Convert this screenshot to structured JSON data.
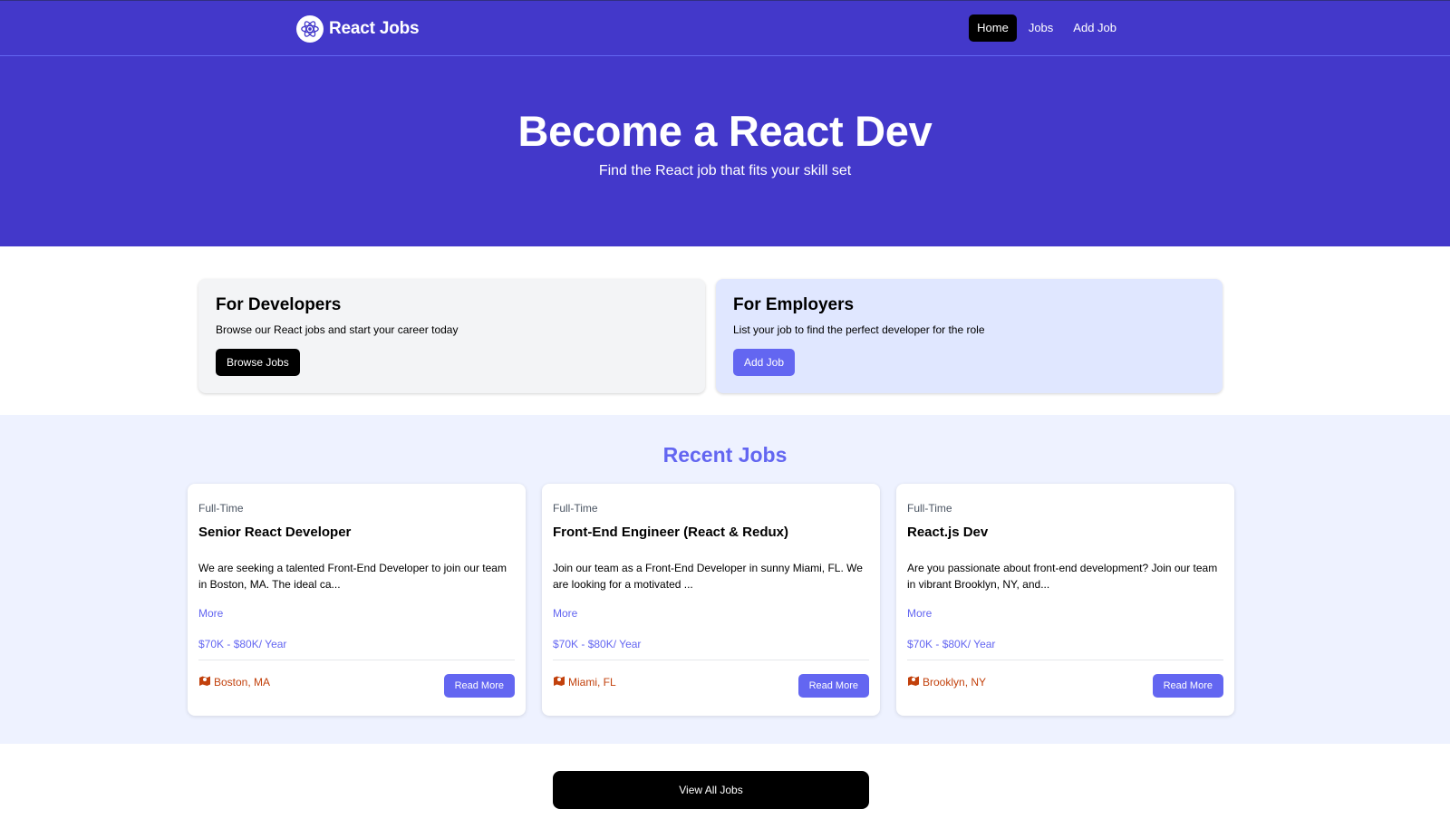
{
  "nav": {
    "brand": "React Jobs",
    "logo_icon": "react-atom-icon",
    "links": [
      {
        "label": "Home",
        "active": true
      },
      {
        "label": "Jobs",
        "active": false
      },
      {
        "label": "Add Job",
        "active": false
      }
    ]
  },
  "hero": {
    "title": "Become a React Dev",
    "subtitle": "Find the React job that fits your skill set"
  },
  "promo": {
    "developers": {
      "title": "For Developers",
      "text": "Browse our React jobs and start your career today",
      "button": "Browse Jobs"
    },
    "employers": {
      "title": "For Employers",
      "text": "List your job to find the perfect developer for the role",
      "button": "Add Job"
    }
  },
  "recent": {
    "heading": "Recent Jobs",
    "jobs": [
      {
        "type": "Full-Time",
        "title": "Senior React Developer",
        "description": "We are seeking a talented Front-End Developer to join our team in Boston, MA. The ideal ca...",
        "more": "More",
        "salary": "$70K - $80K/ Year",
        "location": "Boston, MA",
        "button": "Read More"
      },
      {
        "type": "Full-Time",
        "title": "Front-End Engineer (React & Redux)",
        "description": "Join our team as a Front-End Developer in sunny Miami, FL. We are looking for a motivated ...",
        "more": "More",
        "salary": "$70K - $80K/ Year",
        "location": "Miami, FL",
        "button": "Read More"
      },
      {
        "type": "Full-Time",
        "title": "React.js Dev",
        "description": "Are you passionate about front-end development? Join our team in vibrant Brooklyn, NY, and...",
        "more": "More",
        "salary": "$70K - $80K/ Year",
        "location": "Brooklyn, NY",
        "button": "Read More"
      }
    ]
  },
  "view_all": "View All Jobs",
  "colors": {
    "primary": "#4338ca",
    "accent": "#6366f1",
    "location": "#c2410c"
  }
}
